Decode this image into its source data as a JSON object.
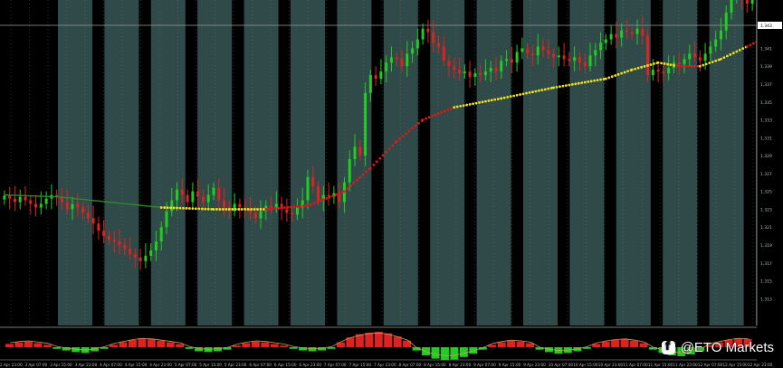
{
  "chart_data": {
    "type": "candlestick",
    "title": "",
    "xlabel": "",
    "ylabel": "",
    "grid": false,
    "current_price_label": "1.343",
    "ylim": [
      1.31,
      1.346
    ],
    "y_ticks": [
      {
        "value": 1.341,
        "label": "1.341"
      },
      {
        "value": 1.339,
        "label": "1.339"
      },
      {
        "value": 1.337,
        "label": "1.337"
      },
      {
        "value": 1.335,
        "label": "1.335"
      },
      {
        "value": 1.333,
        "label": "1.333"
      },
      {
        "value": 1.331,
        "label": "1.331"
      },
      {
        "value": 1.329,
        "label": "1.329"
      },
      {
        "value": 1.327,
        "label": "1.327"
      },
      {
        "value": 1.325,
        "label": "1.325"
      },
      {
        "value": 1.323,
        "label": "1.323"
      },
      {
        "value": 1.321,
        "label": "1.321"
      },
      {
        "value": 1.319,
        "label": "1.319"
      },
      {
        "value": 1.317,
        "label": "1.317"
      },
      {
        "value": 1.315,
        "label": "1.315"
      },
      {
        "value": 1.313,
        "label": "1.313"
      }
    ],
    "x_ticks": [
      "2 Apr 23:00",
      "3 Apr 07:00",
      "3 Apr 15:00",
      "3 Apr 23:00",
      "4 Apr 07:00",
      "4 Apr 15:00",
      "4 Apr 23:00",
      "5 Apr 07:00",
      "5 Apr 15:00",
      "5 Apr 23:00",
      "6 Apr 07:00",
      "6 Apr 15:00",
      "6 Apr 23:00",
      "7 Apr 07:00",
      "7 Apr 15:00",
      "7 Apr 23:00",
      "8 Apr 07:00",
      "8 Apr 15:00",
      "8 Apr 23:00",
      "9 Apr 07:00",
      "9 Apr 15:00",
      "9 Apr 23:00",
      "10 Apr 07:00",
      "10 Apr 15:00",
      "10 Apr 23:00",
      "11 Apr 07:00",
      "11 Apr 15:00",
      "11 Apr 23:00",
      "12 Apr 07:00",
      "12 Apr 15:00",
      "12 Apr 23:00"
    ],
    "session_bands": 21,
    "close_path": [
      1.3245,
      1.3242,
      1.3238,
      1.3244,
      1.324,
      1.3236,
      1.3232,
      1.3236,
      1.3242,
      1.3246,
      1.3244,
      1.3238,
      1.323,
      1.3236,
      1.3232,
      1.3226,
      1.322,
      1.3214,
      1.3206,
      1.32,
      1.3196,
      1.3194,
      1.319,
      1.3186,
      1.318,
      1.3176,
      1.3172,
      1.3178,
      1.3184,
      1.3194,
      1.321,
      1.3228,
      1.324,
      1.3252,
      1.3246,
      1.3238,
      1.325,
      1.3244,
      1.3238,
      1.3246,
      1.3254,
      1.324,
      1.3232,
      1.3228,
      1.3236,
      1.3232,
      1.323,
      1.3226,
      1.322,
      1.3228,
      1.3234,
      1.3232,
      1.3236,
      1.323,
      1.3226,
      1.3224,
      1.3232,
      1.324,
      1.3266,
      1.3256,
      1.324,
      1.3246,
      1.3244,
      1.3248,
      1.3238,
      1.326,
      1.3286,
      1.33,
      1.329,
      1.336,
      1.338,
      1.3376,
      1.3384,
      1.3394,
      1.34,
      1.3398,
      1.339,
      1.3404,
      1.341,
      1.342,
      1.3432,
      1.3428,
      1.3416,
      1.3412,
      1.3396,
      1.339,
      1.3386,
      1.3382,
      1.3384,
      1.3378,
      1.3382,
      1.338,
      1.3384,
      1.3388,
      1.3384,
      1.3396,
      1.3398,
      1.3394,
      1.3406,
      1.341,
      1.3404,
      1.3402,
      1.3412,
      1.3408,
      1.3404,
      1.34,
      1.3402,
      1.3398,
      1.3396,
      1.34,
      1.3394,
      1.339,
      1.3402,
      1.3408,
      1.3416,
      1.342,
      1.3426,
      1.3422,
      1.343,
      1.3428,
      1.3426,
      1.3432,
      1.3424,
      1.338,
      1.3386,
      1.3384,
      1.3382,
      1.3388,
      1.3394,
      1.3392,
      1.3398,
      1.3404,
      1.34,
      1.3396,
      1.3404,
      1.3412,
      1.342,
      1.343,
      1.345,
      1.3466,
      1.347,
      1.3466,
      1.346,
      1.347
    ],
    "moving_average": [
      [
        0,
        1.3246
      ],
      [
        10,
        1.3244
      ],
      [
        20,
        1.3238
      ],
      [
        30,
        1.3232
      ],
      [
        40,
        1.323
      ],
      [
        50,
        1.323
      ],
      [
        58,
        1.3234
      ],
      [
        65,
        1.325
      ],
      [
        70,
        1.3276
      ],
      [
        75,
        1.3306
      ],
      [
        80,
        1.333
      ],
      [
        86,
        1.3344
      ],
      [
        95,
        1.3354
      ],
      [
        105,
        1.3366
      ],
      [
        115,
        1.3376
      ],
      [
        120,
        1.3386
      ],
      [
        125,
        1.3394
      ],
      [
        129,
        1.339
      ],
      [
        133,
        1.339
      ],
      [
        137,
        1.3398
      ],
      [
        142,
        1.3412
      ],
      [
        147,
        1.3426
      ]
    ],
    "moving_average_colors": [
      "#2e8b2e",
      "#e01818",
      "#f0e020"
    ],
    "candle_up_color": "#22cc22",
    "candle_down_color": "#dd2222",
    "band_color": "#2f4a48",
    "indicator": {
      "values": [
        0.4,
        0.6,
        0.7,
        0.5,
        0.3,
        -0.2,
        -0.4,
        -0.6,
        -0.7,
        -0.5,
        -0.2,
        0.3,
        0.6,
        0.9,
        1.1,
        1.0,
        0.8,
        0.6,
        0.4,
        -0.2,
        -0.5,
        -0.6,
        -0.5,
        -0.3,
        0.2,
        0.5,
        0.7,
        0.6,
        0.4,
        0.2,
        -0.2,
        -0.4,
        -0.5,
        -0.4,
        -0.2,
        0.6,
        1.2,
        1.6,
        1.8,
        1.9,
        1.7,
        1.3,
        0.8,
        -0.4,
        -1.0,
        -1.4,
        -1.6,
        -1.5,
        -1.2,
        -0.8,
        -0.3,
        0.3,
        0.6,
        0.8,
        0.7,
        0.5,
        -0.3,
        -0.6,
        -0.8,
        -0.7,
        -0.5,
        -0.2,
        0.4,
        0.7,
        0.9,
        1.0,
        0.8,
        0.5,
        -0.3,
        -0.7,
        -1.0,
        -1.1,
        -0.9,
        -0.5,
        0.3,
        0.6,
        0.9,
        1.1,
        1.0
      ],
      "up_color": "#dd2222",
      "down_color": "#22cc22"
    }
  },
  "watermark": {
    "icon": "facebook-icon",
    "text": "@ETO Markets"
  }
}
